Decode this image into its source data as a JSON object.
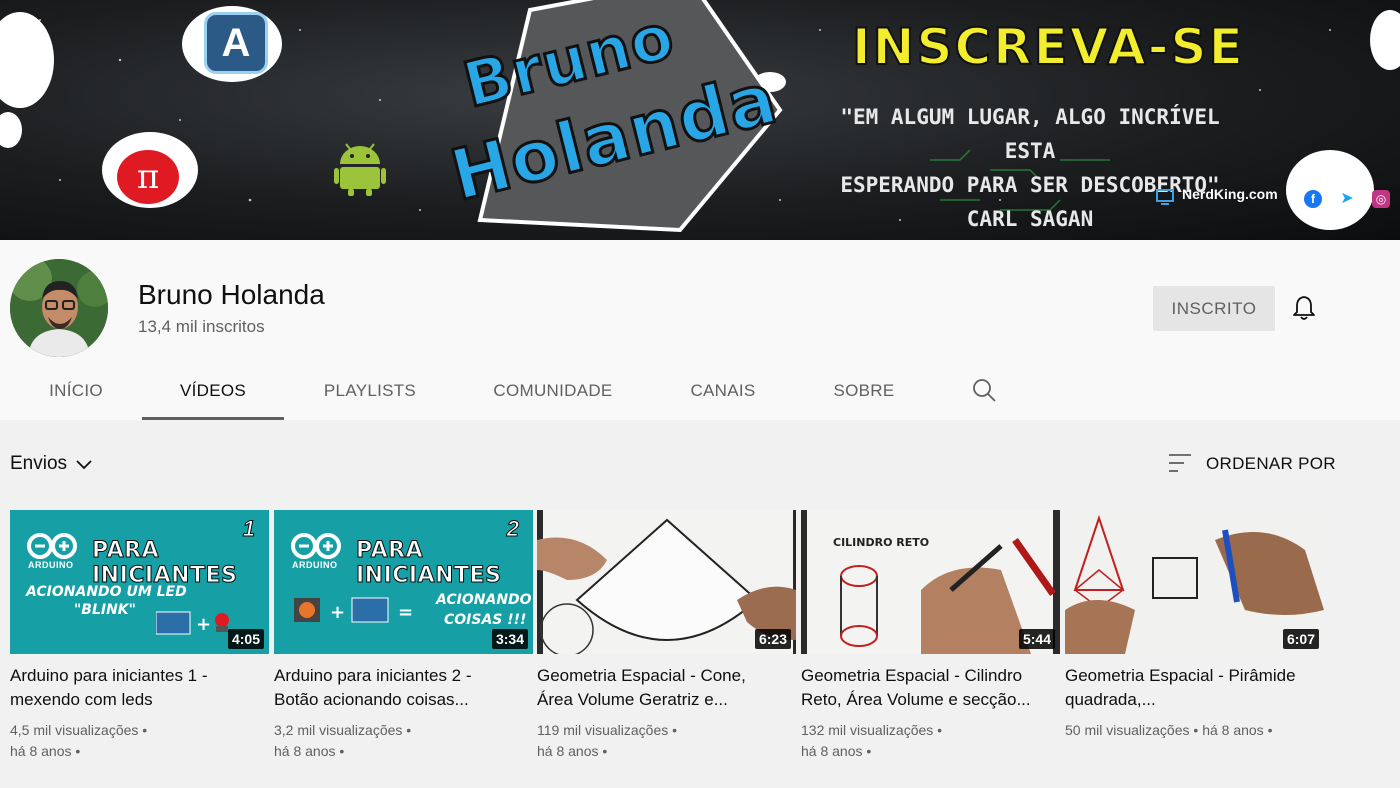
{
  "banner": {
    "name_line1": "Bruno",
    "name_line2": "Holanda",
    "cta": "INSCREVA-SE",
    "quote_line1": "\"EM ALGUM LUGAR, ALGO INCRÍVEL ESTA",
    "quote_line2": "ESPERANDO PARA SER DESCOBERTO\"",
    "quote_author": "CARL SAGAN",
    "website": "NerdKing.com",
    "pi_symbol": "π",
    "app_letter": "A"
  },
  "channel": {
    "name": "Bruno Holanda",
    "subscribers": "13,4 mil inscritos",
    "subscribe_button": "INSCRITO"
  },
  "tabs": [
    {
      "label": "INÍCIO"
    },
    {
      "label": "VÍDEOS"
    },
    {
      "label": "PLAYLISTS"
    },
    {
      "label": "COMUNIDADE"
    },
    {
      "label": "CANAIS"
    },
    {
      "label": "SOBRE"
    }
  ],
  "toolbar": {
    "filter_label": "Envios",
    "sort_label": "ORDENAR POR"
  },
  "videos": [
    {
      "title": "Arduino para iniciantes 1 - mexendo com leds",
      "duration": "4:05",
      "views": "4,5 mil visualizações",
      "age": "há 8 anos",
      "thumb_head": "PARA INICIANTES",
      "thumb_num": "1",
      "thumb_line1": "ACIONANDO UM LED",
      "thumb_line2": "\"BLINK\""
    },
    {
      "title": "Arduino para iniciantes 2 - Botão acionando coisas...",
      "duration": "3:34",
      "views": "3,2 mil visualizações",
      "age": "há 8 anos",
      "thumb_head": "PARA INICIANTES",
      "thumb_num": "2",
      "thumb_line1": "ACIONANDO",
      "thumb_line2": "COISAS !!!"
    },
    {
      "title": "Geometria Espacial - Cone, Área Volume Geratriz e...",
      "duration": "6:23",
      "views": "119 mil visualizações",
      "age": "há 8 anos"
    },
    {
      "title": "Geometria Espacial - Cilindro Reto, Área Volume e secção...",
      "duration": "5:44",
      "views": "132 mil visualizações",
      "age": "há 8 anos",
      "thumb_text": "CILINDRO RETO"
    },
    {
      "title": "Geometria Espacial - Pirâmide quadrada,...",
      "duration": "6:07",
      "views": "50 mil visualizações",
      "age": "há 8 anos"
    }
  ],
  "arduino_word": "ARDUINO",
  "icons": {
    "search": "search-icon",
    "bell": "bell-icon",
    "sort": "sort-icon",
    "chevron": "chevron-down-icon"
  },
  "colors": {
    "banner_name": "#29a6e6",
    "banner_cta": "#f2ee2e",
    "thumb_teal": "#16a0a6",
    "pi_red": "#e01a22"
  }
}
